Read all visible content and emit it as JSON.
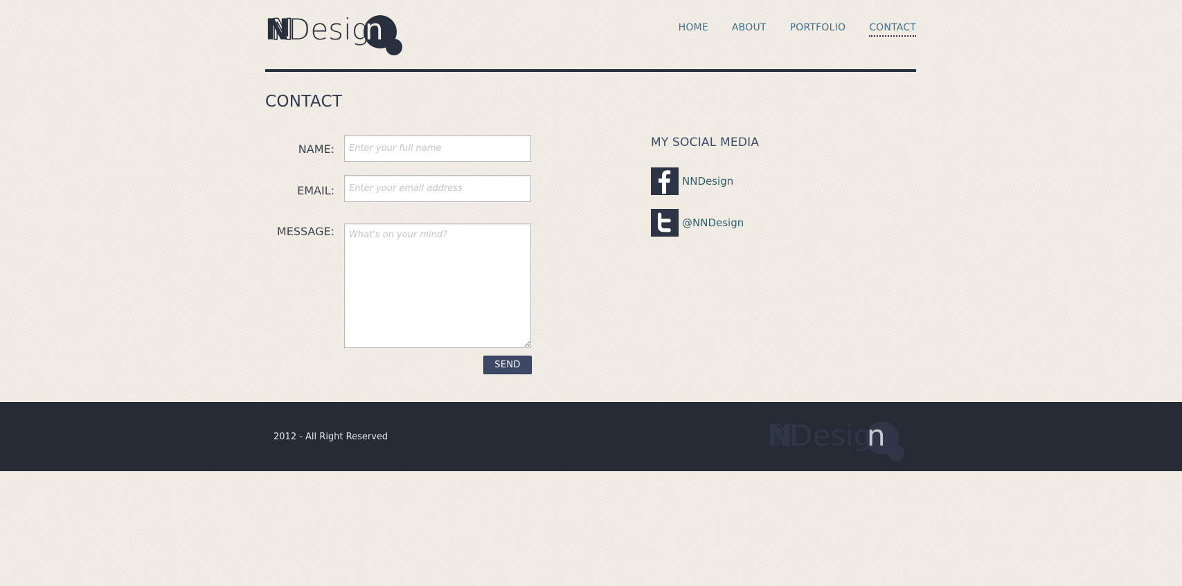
{
  "brand": {
    "logo_text": "NNDesign",
    "colors": {
      "dark": "#283040",
      "link": "#3f6f8c",
      "button": "#3c4866",
      "footer_bg": "#252a34"
    }
  },
  "nav": {
    "items": [
      {
        "label": "HOME",
        "active": false
      },
      {
        "label": "ABOUT",
        "active": false
      },
      {
        "label": "PORTFOLIO",
        "active": false
      },
      {
        "label": "CONTACT",
        "active": true
      }
    ]
  },
  "page": {
    "title": "CONTACT"
  },
  "form": {
    "name_label": "NAME:",
    "name_placeholder": "Enter your full name",
    "name_value": "",
    "email_label": "EMAIL:",
    "email_placeholder": "Enter your email address",
    "email_value": "",
    "message_label": "MESSAGE:",
    "message_placeholder": "What's on your mind?",
    "message_value": "",
    "send_label": "SEND"
  },
  "social": {
    "title": "MY SOCIAL MEDIA",
    "items": [
      {
        "icon": "facebook-icon",
        "label": "NNDesign"
      },
      {
        "icon": "twitter-icon",
        "label": "@NNDesign"
      }
    ]
  },
  "footer": {
    "copyright": "2012 - All Right Reserved",
    "logo_text": "NNDesign"
  }
}
